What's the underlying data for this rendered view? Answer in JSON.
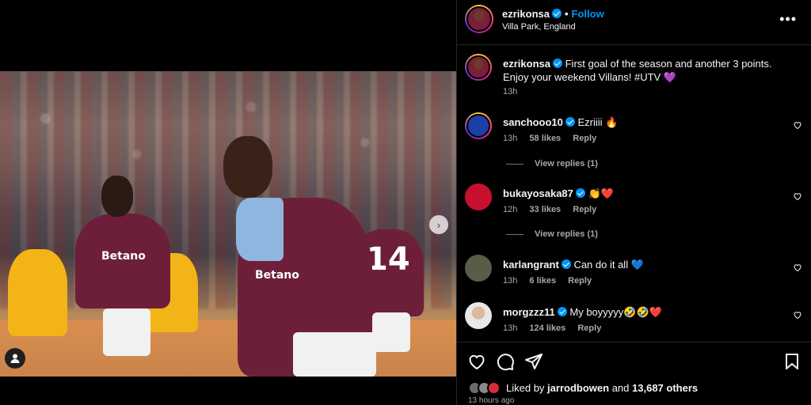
{
  "header": {
    "username": "ezrikonsa",
    "follow_label": "Follow",
    "location": "Villa Park, England",
    "more_label": "•••"
  },
  "media": {
    "sponsor_left": "Betano",
    "sponsor_main": "Betano",
    "shirt_number": "14"
  },
  "caption": {
    "username": "ezrikonsa",
    "text": "First goal of the season and another 3 points. Enjoy your weekend Villans! #UTV 💜",
    "time": "13h"
  },
  "comments": [
    {
      "username": "sanchooo10",
      "text": "Ezriiii 🔥",
      "time": "13h",
      "likes": "58 likes",
      "reply": "Reply",
      "view_replies": "View replies (1)",
      "avatar_color": "#1d3fa8"
    },
    {
      "username": "bukayosaka87",
      "text": "👏❤️",
      "time": "12h",
      "likes": "33 likes",
      "reply": "Reply",
      "view_replies": "View replies (1)",
      "avatar_color": "#c8102e"
    },
    {
      "username": "karlangrant",
      "text": "Can do it all 💙",
      "time": "13h",
      "likes": "6 likes",
      "reply": "Reply",
      "avatar_color": "#5b5b4a"
    },
    {
      "username": "morgzzz11",
      "text": "My boyyyyy🤣🤣❤️",
      "time": "13h",
      "likes": "124 likes",
      "reply": "Reply",
      "avatar_color": "#e8e8e8"
    }
  ],
  "likes_summary": {
    "prefix": "Liked by",
    "user": "jarrodbowen",
    "middle": "and",
    "count": "13,687 others"
  },
  "posted": "13 hours ago",
  "colors": {
    "accent": "#0095f6",
    "background": "#000000",
    "secondary_text": "#a8a8a8",
    "villa_claret": "#6d1f3a",
    "villa_blue": "#8fb6de",
    "wolves_gold": "#f2b417"
  }
}
